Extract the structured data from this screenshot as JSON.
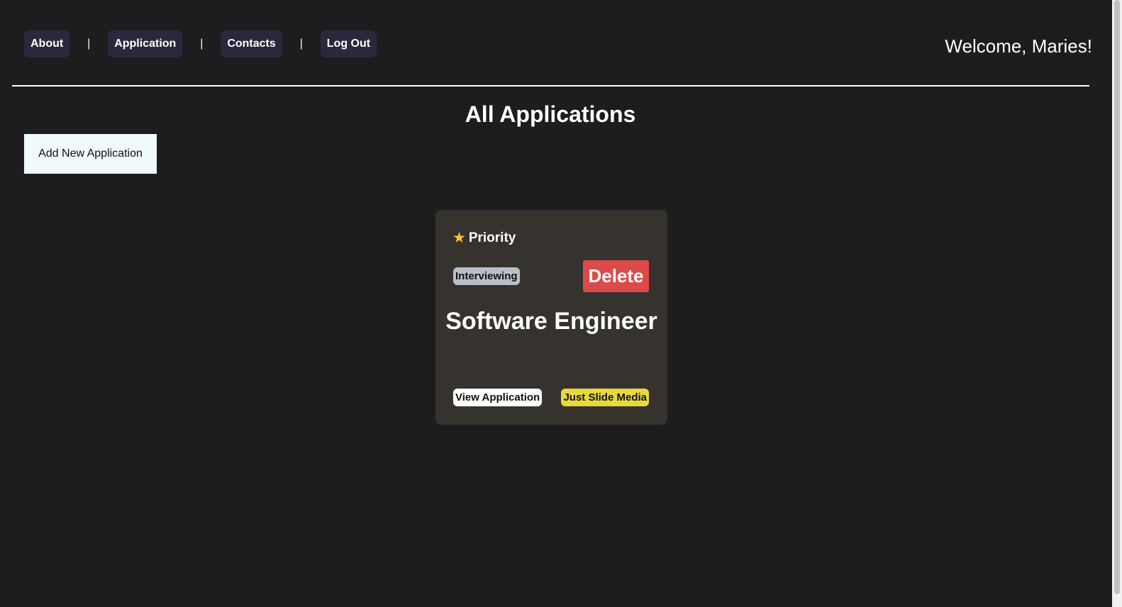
{
  "nav": {
    "items": [
      {
        "label": "About"
      },
      {
        "label": "Application"
      },
      {
        "label": "Contacts"
      },
      {
        "label": "Log Out"
      }
    ],
    "separator": "|"
  },
  "header": {
    "welcome": "Welcome, Maries!"
  },
  "main": {
    "title": "All Applications",
    "add_button_label": "Add New Application",
    "applications": [
      {
        "priority_icon": "star-icon",
        "priority_label": "Priority",
        "status": "Interviewing",
        "delete_label": "Delete",
        "job_title": "Software Engineer",
        "view_label": "View Application",
        "company": "Just Slide Media"
      }
    ]
  },
  "colors": {
    "background": "#1d1d1f",
    "nav_button": "#2b283d",
    "card": "#36332f",
    "delete": "#dd4a4a",
    "status_badge": "#b8bfc9",
    "company_badge": "#e8d93f",
    "add_button": "#effafa"
  }
}
